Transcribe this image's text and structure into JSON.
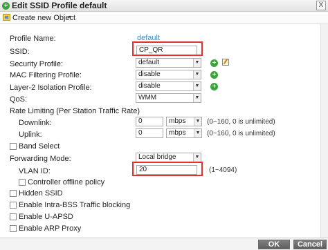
{
  "window": {
    "title": "Edit SSID Profile default",
    "close_glyph": "X"
  },
  "toolbar": {
    "create_label": "Create new Object",
    "caret": "▾"
  },
  "form": {
    "profile_name": {
      "label": "Profile Name:",
      "value": "default"
    },
    "ssid": {
      "label": "SSID:",
      "value": "CP_QR"
    },
    "security_profile": {
      "label": "Security Profile:",
      "value": "default"
    },
    "mac_filtering_profile": {
      "label": "MAC Filtering Profile:",
      "value": "disable"
    },
    "layer2_isolation_profile": {
      "label": "Layer-2 Isolation Profile:",
      "value": "disable"
    },
    "qos": {
      "label": "QoS:",
      "value": "WMM"
    },
    "rate_limiting": {
      "label": "Rate Limiting (Per Station Traffic Rate)",
      "downlink": {
        "label": "Downlink:",
        "value": "0",
        "unit": "mbps",
        "hint": "(0~160, 0 is unlimited)"
      },
      "uplink": {
        "label": "Uplink:",
        "value": "0",
        "unit": "mbps",
        "hint": "(0~160, 0 is unlimited)"
      }
    },
    "band_select": {
      "label": "Band Select"
    },
    "forwarding_mode": {
      "label": "Forwarding Mode:",
      "value": "Local bridge"
    },
    "vlan_id": {
      "label": "VLAN ID:",
      "value": "20",
      "hint": "(1~4094)"
    },
    "controller_offline_policy": {
      "label": "Controller offline policy"
    },
    "hidden_ssid": {
      "label": "Hidden SSID"
    },
    "intra_bss": {
      "label": "Enable Intra-BSS Traffic blocking"
    },
    "u_apsd": {
      "label": "Enable U-APSD"
    },
    "arp_proxy": {
      "label": "Enable ARP Proxy"
    }
  },
  "footer": {
    "ok_label": "OK",
    "cancel_label": "Cancel"
  },
  "colors": {
    "accent_green": "#3aa23a",
    "highlight_red": "#e03030",
    "link_blue": "#3a8fc8"
  }
}
